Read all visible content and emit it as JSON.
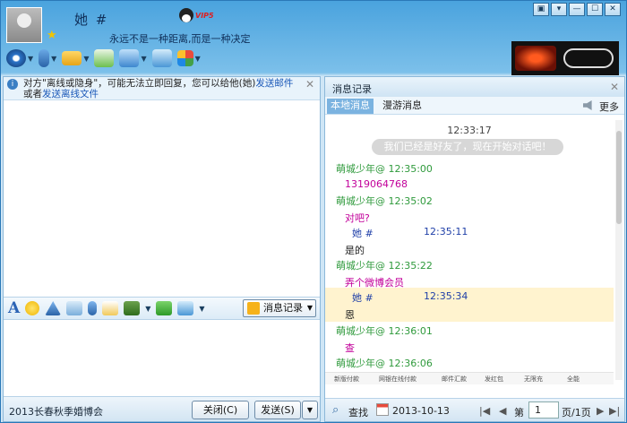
{
  "header": {
    "contact_name": "她 #",
    "vip": "VIP5",
    "signature": "永远不是一种距离,而是一种决定",
    "window_buttons": [
      "▣",
      "▾",
      "—",
      "☐",
      "✕"
    ]
  },
  "notice": {
    "text": "对方\"离线或隐身\"，可能无法立即回复，您可以给他(她)",
    "link1": "发送邮件",
    "or": "或者",
    "link2": "发送离线文件"
  },
  "compose": {
    "history_label": "消息记录"
  },
  "bottom": {
    "ad_text": "2013长春秋季婚博会",
    "close_label": "关闭(C)",
    "send_label": "发送(S)"
  },
  "history": {
    "title": "消息记录",
    "tab_local": "本地消息",
    "tab_roaming": "漫游消息",
    "more": "更多",
    "first_time": "12:33:17",
    "system_msg": "我们已经是好友了，现在开始对话吧！",
    "messages": [
      {
        "sender": "萌城少年@",
        "time": "12:35:00",
        "text": "1319064768"
      },
      {
        "sender": "萌城少年@",
        "time": "12:35:02",
        "text": "对吧?"
      },
      {
        "sender": "她 #",
        "time": "12:35:11",
        "text": "是的"
      },
      {
        "sender": "萌城少年@",
        "time": "12:35:22",
        "text": "弄个微博会员"
      },
      {
        "sender": "她 #",
        "time": "12:35:34",
        "text": "恩"
      },
      {
        "sender": "萌城少年@",
        "time": "12:36:01",
        "text": "查"
      },
      {
        "sender": "萌城少年@",
        "time": "12:36:06",
        "text": ""
      }
    ],
    "search": "查找",
    "date": "2013-10-13",
    "page_label": "第",
    "page": "1",
    "page_total": "页/1页",
    "strip_items": [
      "新版付款",
      "网银在线付款",
      "邮件汇款",
      "发红包",
      "无限充",
      "全能"
    ]
  }
}
